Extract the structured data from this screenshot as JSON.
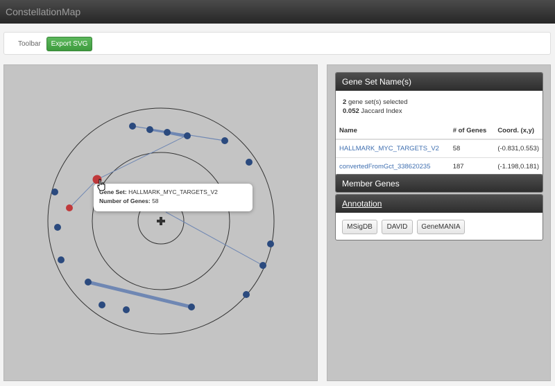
{
  "app": {
    "title": "ConstellationMap"
  },
  "toolbar": {
    "label": "Toolbar",
    "export_label": "Export SVG"
  },
  "gene_set_panel": {
    "title": "Gene Set Name(s)",
    "selected_count": "2",
    "selected_text": "gene set(s) selected",
    "jaccard_value": "0.052",
    "jaccard_text": "Jaccard Index",
    "columns": [
      "Name",
      "# of Genes",
      "Coord. (x,y)"
    ],
    "rows": [
      {
        "name": "HALLMARK_MYC_TARGETS_V2",
        "genes": "58",
        "coord": "(-0.831,0.553)"
      },
      {
        "name": "convertedFromGct_338620235",
        "genes": "187",
        "coord": "(-1.198,0.181)"
      }
    ]
  },
  "member_genes_panel": {
    "title": "Member Genes"
  },
  "annotation_panel": {
    "title": "Annotation",
    "buttons": [
      "MSigDB",
      "DAVID",
      "GeneMANIA"
    ]
  },
  "tooltip": {
    "set_label": "Gene Set:",
    "set_value": "HALLMARK_MYC_TARGETS_V2",
    "count_label": "Number of Genes:",
    "count_value": "58"
  },
  "colors": {
    "node": "#2b4a7e",
    "selected_node": "#c0393b",
    "edge": "#6f87b3",
    "ring": "#333333",
    "map_bg": "#c4c4c4"
  },
  "icons": {
    "center": "plus-icon",
    "cursor": "hand-pointer-icon"
  }
}
